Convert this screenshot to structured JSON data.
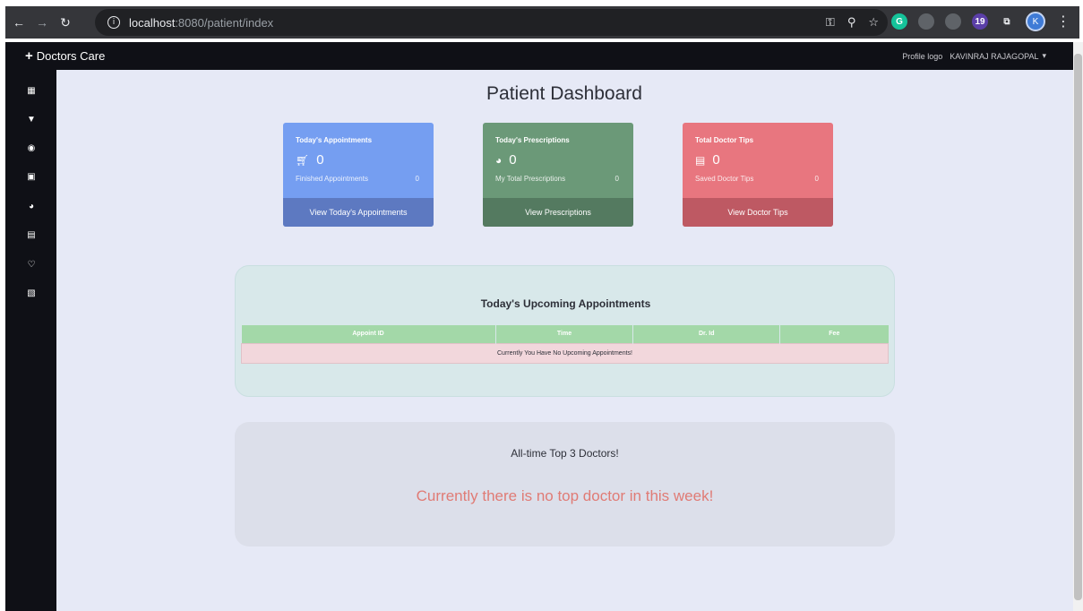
{
  "browser": {
    "url_host": "localhost",
    "url_path": ":8080/patient/index",
    "ext_badge": "19",
    "avatar_letter": "K"
  },
  "navbar": {
    "brand": "Doctors Care",
    "profile_logo_alt": "Profile logo",
    "user_name": "KAVINRAJ RAJAGOPAL"
  },
  "page": {
    "title": "Patient Dashboard"
  },
  "cards": [
    {
      "heading": "Today's Appointments",
      "count": "0",
      "sub_label": "Finished Appointments",
      "sub_value": "0",
      "footer": "View Today's Appointments",
      "icon": "cart-icon"
    },
    {
      "heading": "Today's Prescriptions",
      "count": "0",
      "sub_label": "My Total Prescriptions",
      "sub_value": "0",
      "footer": "View Prescriptions",
      "icon": "clock-icon"
    },
    {
      "heading": "Total Doctor Tips",
      "count": "0",
      "sub_label": "Saved Doctor Tips",
      "sub_value": "0",
      "footer": "View Doctor Tips",
      "icon": "newspaper-icon"
    }
  ],
  "appointments": {
    "title": "Today's Upcoming Appointments",
    "columns": [
      "Appoint ID",
      "Time",
      "Dr. Id",
      "Fee"
    ],
    "empty_message": "Currently You Have No Upcoming Appointments!"
  },
  "top_doctors": {
    "title": "All-time Top 3 Doctors!",
    "empty_message": "Currently there is no top doctor in this week!"
  },
  "colors": {
    "card_blue": "#759ef1",
    "card_green": "#6b9978",
    "card_red": "#e8767f",
    "empty_message": "#e07b75"
  }
}
